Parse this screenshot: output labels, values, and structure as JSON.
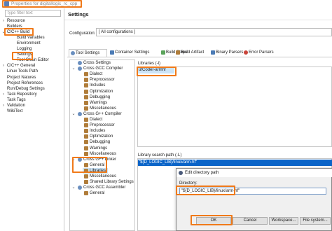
{
  "window": {
    "title": "Properties for digitallogic_rc_cpp"
  },
  "filter": {
    "placeholder": "type filter text"
  },
  "nav": {
    "items": [
      {
        "label": "Resource",
        "indent": 1,
        "twisty": "›"
      },
      {
        "label": "Builders",
        "indent": 1,
        "twisty": ""
      },
      {
        "label": "C/C++ Build",
        "indent": 1,
        "twisty": "⌄"
      },
      {
        "label": "Build Variables",
        "indent": 2,
        "twisty": ""
      },
      {
        "label": "Environment",
        "indent": 2,
        "twisty": ""
      },
      {
        "label": "Logging",
        "indent": 2,
        "twisty": ""
      },
      {
        "label": "Settings",
        "indent": 2,
        "twisty": ""
      },
      {
        "label": "Tool Chain Editor",
        "indent": 2,
        "twisty": ""
      },
      {
        "label": "C/C++ General",
        "indent": 1,
        "twisty": "›"
      },
      {
        "label": "Linux Tools Path",
        "indent": 1,
        "twisty": ""
      },
      {
        "label": "Project Natures",
        "indent": 1,
        "twisty": ""
      },
      {
        "label": "Project References",
        "indent": 1,
        "twisty": ""
      },
      {
        "label": "Run/Debug Settings",
        "indent": 1,
        "twisty": ""
      },
      {
        "label": "Task Repository",
        "indent": 1,
        "twisty": "›"
      },
      {
        "label": "Task Tags",
        "indent": 1,
        "twisty": ""
      },
      {
        "label": "Validation",
        "indent": 1,
        "twisty": "›"
      },
      {
        "label": "WikiText",
        "indent": 1,
        "twisty": ""
      }
    ]
  },
  "settings": {
    "title": "Settings",
    "configuration_label": "Configuration:",
    "configuration_value": "[ All configurations ]"
  },
  "tabs": [
    "Tool Settings",
    "Container Settings",
    "Build Steps",
    "Build Artifact",
    "Binary Parsers",
    "Error Parsers"
  ],
  "tool_tree": [
    {
      "label": "Cross Settings",
      "indent": 0,
      "twisty": ""
    },
    {
      "label": "Cross GCC Compiler",
      "indent": 0,
      "twisty": "⌄"
    },
    {
      "label": "Dialect",
      "indent": 1,
      "twisty": ""
    },
    {
      "label": "Preprocessor",
      "indent": 1,
      "twisty": ""
    },
    {
      "label": "Includes",
      "indent": 1,
      "twisty": ""
    },
    {
      "label": "Optimization",
      "indent": 1,
      "twisty": ""
    },
    {
      "label": "Debugging",
      "indent": 1,
      "twisty": ""
    },
    {
      "label": "Warnings",
      "indent": 1,
      "twisty": ""
    },
    {
      "label": "Miscellaneous",
      "indent": 1,
      "twisty": ""
    },
    {
      "label": "Cross G++ Compiler",
      "indent": 0,
      "twisty": "⌄"
    },
    {
      "label": "Dialect",
      "indent": 1,
      "twisty": ""
    },
    {
      "label": "Preprocessor",
      "indent": 1,
      "twisty": ""
    },
    {
      "label": "Includes",
      "indent": 1,
      "twisty": ""
    },
    {
      "label": "Optimization",
      "indent": 1,
      "twisty": ""
    },
    {
      "label": "Debugging",
      "indent": 1,
      "twisty": ""
    },
    {
      "label": "Warnings",
      "indent": 1,
      "twisty": ""
    },
    {
      "label": "Miscellaneous",
      "indent": 1,
      "twisty": ""
    },
    {
      "label": "Cross G++ Linker",
      "indent": 0,
      "twisty": "⌄"
    },
    {
      "label": "General",
      "indent": 1,
      "twisty": ""
    },
    {
      "label": "Libraries",
      "indent": 1,
      "twisty": ""
    },
    {
      "label": "Miscellaneous",
      "indent": 1,
      "twisty": ""
    },
    {
      "label": "Shared Library Settings",
      "indent": 1,
      "twisty": ""
    },
    {
      "label": "Cross GCC Assembler",
      "indent": 0,
      "twisty": "⌄"
    },
    {
      "label": "General",
      "indent": 1,
      "twisty": ""
    }
  ],
  "libraries": {
    "label": "Libraries (-l)",
    "items": [
      "ufCoder-armhf"
    ]
  },
  "library_path": {
    "label": "Library search path (-L)",
    "items": [
      "\"${D_LOGIC_LIB}/linux/arm-hf\""
    ]
  },
  "dialog": {
    "title": "Edit directory path",
    "directory_label": "Directory:",
    "directory_value": "\"${D_LOGIC_LIB}/linux/arm-hf\"",
    "ok": "OK",
    "cancel": "Cancel",
    "workspace": "Workspace...",
    "filesystem": "File system..."
  },
  "colors": {
    "highlight": "#f07a1a",
    "selection": "#0a64c8"
  }
}
